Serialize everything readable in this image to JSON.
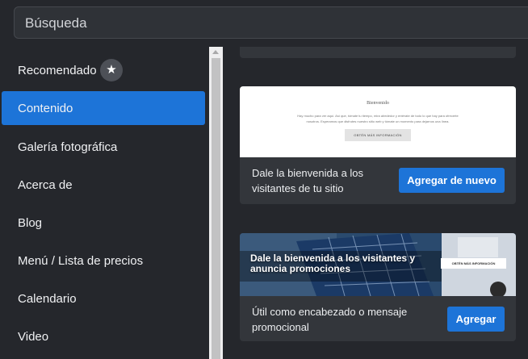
{
  "search": {
    "label": "Búsqueda"
  },
  "sidebar": {
    "items": [
      {
        "label": "Recomendado",
        "badge_icon": "star-icon"
      },
      {
        "label": "Contenido",
        "active": true
      },
      {
        "label": "Galería fotográfica"
      },
      {
        "label": "Acerca de"
      },
      {
        "label": "Blog"
      },
      {
        "label": "Menú / Lista de precios"
      },
      {
        "label": "Calendario"
      },
      {
        "label": "Video"
      }
    ]
  },
  "cards": {
    "welcome": {
      "preview_title": "Bienvenido",
      "preview_line1": "Hay mucho para ver aquí. Así que, tómate tu tiempo, mira alrededor y entérate de todo lo que hay para ofrecerte",
      "preview_line2": "nosotros. Esperamos que disfrutes nuestro sitio web y tómate un momento para dejarnos una línea.",
      "preview_button": "OBTÉN MÁS INFORMACIÓN",
      "description": "Dale la bienvenida a los visitantes de tu sitio",
      "button": "Agregar de nuevo"
    },
    "promo": {
      "headline": "Dale la bienvenida a los visitantes y anuncia promociones",
      "preview_button": "OBTÉN MÁS INFORMACIÓN",
      "description": "Útil como encabezado o mensaje promocional",
      "button": "Agregar"
    }
  },
  "colors": {
    "background": "#25272c",
    "accent": "#1d74d8",
    "card": "#33363b"
  }
}
